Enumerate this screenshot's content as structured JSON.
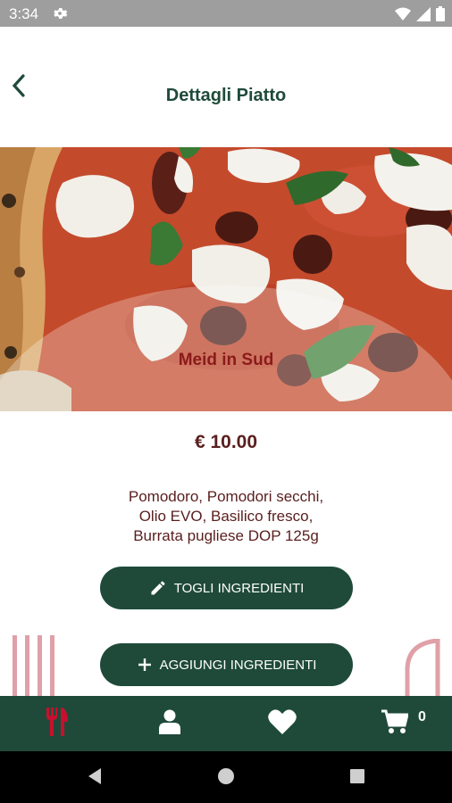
{
  "status_bar": {
    "time": "3:34",
    "icons": [
      "gear-icon",
      "wifi-icon",
      "signal-icon",
      "battery-icon"
    ]
  },
  "header": {
    "title": "Dettagli Piatto",
    "back_icon": "chevron-left-icon"
  },
  "dish": {
    "image_caption": "Meid in Sud",
    "price": "€ 10.00",
    "ingredients_lines": [
      "Pomodoro, Pomodori secchi,",
      "Olio EVO, Basilico fresco,",
      "Burrata pugliese DOP 125g"
    ]
  },
  "actions": {
    "remove_label": "TOGLI INGREDIENTI",
    "remove_icon": "pencil-icon",
    "add_label": "AGGIUNGI INGREDIENTI",
    "add_icon": "plus-icon"
  },
  "bottom_nav": {
    "items": [
      "fork-knife-icon",
      "user-icon",
      "heart-icon",
      "cart-icon"
    ],
    "cart_count": "0"
  },
  "colors": {
    "primary": "#1f4a3a",
    "accent": "#c8102e",
    "text_dark_red": "#5a1e1e",
    "caption_red": "#8b1a1a",
    "deco_pink": "#e0a0a8"
  }
}
